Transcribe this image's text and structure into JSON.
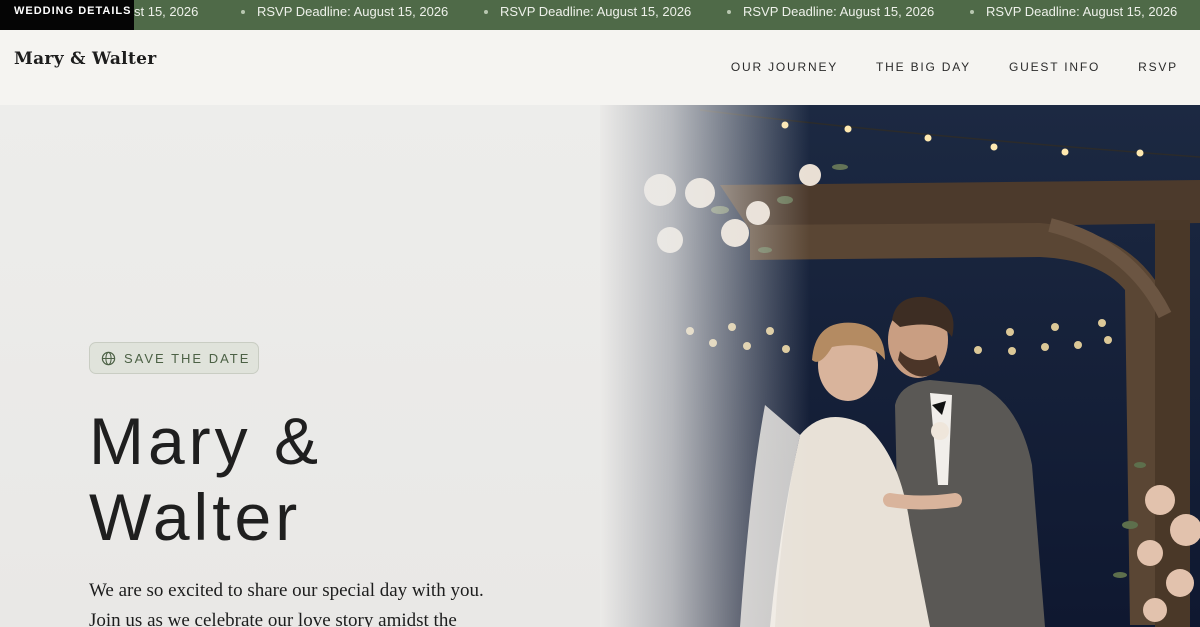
{
  "ticker": {
    "badge": "WEDDING DETAILS",
    "items": [
      "RSVP Deadline: August 15, 2026",
      "RSVP Deadline: August 15, 2026",
      "RSVP Deadline: August 15, 2026",
      "RSVP Deadline: August 15, 2026",
      "RSVP Deadline: August 15, 2026"
    ],
    "partial": "st 15, 2026"
  },
  "header": {
    "logo": "Mary & Walter",
    "nav": [
      "OUR JOURNEY",
      "THE BIG DAY",
      "GUEST INFO",
      "RSVP"
    ]
  },
  "hero": {
    "badge_icon": "globe-icon",
    "badge_label": "SAVE THE DATE",
    "title_line1": "Mary &",
    "title_line2": "Walter",
    "text_line1": "We are so excited to share our special day with you.",
    "text_line2": "Join us as we celebrate our love story amidst the"
  },
  "colors": {
    "ticker_bg": "#4f6a48",
    "accent_green": "#4c6145",
    "page_bg": "#f5f4f1"
  }
}
